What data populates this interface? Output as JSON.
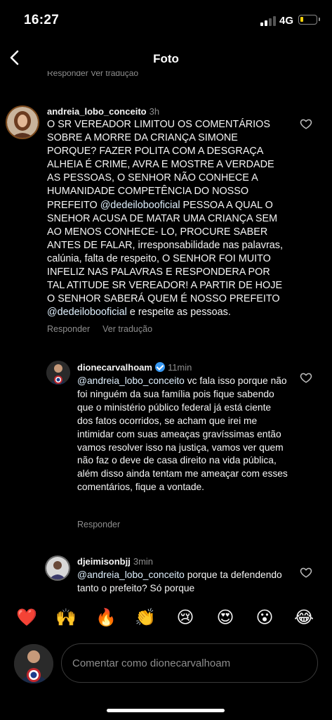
{
  "status_bar": {
    "time": "16:27",
    "network": "4G",
    "battery_level": 0.2,
    "battery_color": "#f5d10b"
  },
  "nav": {
    "title": "Foto",
    "back_icon": "chevron-left-icon"
  },
  "top_cutoff_text": "Responder     Ver tradução",
  "comments": [
    {
      "username": "andreia_lobo_conceito",
      "time": "3h",
      "verified": false,
      "text_parts": [
        "O SR VEREADOR LIMITOU OS COMENTÁRIOS SOBRE A MORRE DA CRIANÇA SIMONE PORQUE? FAZER POLITA COM A DESGRAÇA ALHEIA É CRIME, AVRA E MOSTRE A VERDADE AS PESSOAS, O SENHOR NÃO CONHECE A HUMANIDADE COMPETÊNCIA  DO NOSSO PREFEITO ",
        "@dedeilobooficial",
        "  PESSOA A QUAL O SNEHOR ACUSA DE MATAR UMA CRIANÇA SEM AO MENOS CONHECE- LO, PROCURE SABER ANTES DE FALAR, irresponsabilidade nas palavras, calúnia, falta de respeito, O SENHOR FOI MUITO INFELIZ NAS PALAVRAS E RESPONDERA POR  TAL ATITUDE SR VEREADOR! A PARTIR DE HOJE O SENHOR SABERÁ QUEM É NOSSO PREFEITO ",
        "@dedeilobooficial",
        " e respeite as pessoas."
      ],
      "reply_label": "Responder",
      "translate_label": "Ver tradução"
    },
    {
      "username": "dionecarvalhoam",
      "time": "11min",
      "verified": true,
      "text_parts": [
        "@andreia_lobo_conceito",
        " vc fala isso porque não foi ninguém da sua  família pois fique sabendo que o ministério público federal já está ciente dos fatos ocorridos,  se acham que irei me intimidar com suas ameaças gravíssimas então vamos resolver isso na justiça, vamos ver quem não faz o deve de casa direito na vida pública,  além disso ainda tentam me ameaçar  com esses comentários,  fique a vontade."
      ],
      "reply_label": "Responder"
    },
    {
      "username": "djeimisonbjj",
      "time": "3min",
      "verified": false,
      "text_parts": [
        "@andreia_lobo_conceito",
        " porque ta defendendo tanto o prefeito? Só porque"
      ]
    }
  ],
  "emoji_bar": [
    "❤️",
    "🙌",
    "🔥",
    "👏",
    "😢",
    "😍",
    "😮",
    "😂"
  ],
  "comment_input": {
    "placeholder": "Comentar como dionecarvalhoam"
  }
}
